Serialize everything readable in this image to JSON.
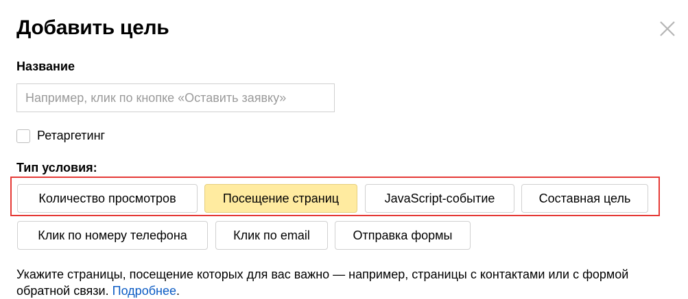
{
  "dialog": {
    "title": "Добавить цель",
    "close_icon": "close-icon"
  },
  "name_field": {
    "label": "Название",
    "value": "",
    "placeholder": "Например, клик по кнопке «Оставить заявку»"
  },
  "retargeting": {
    "label": "Ретаргетинг",
    "checked": false
  },
  "condition_type": {
    "label": "Тип условия:",
    "options": [
      {
        "label": "Количество просмотров",
        "selected": false
      },
      {
        "label": "Посещение страниц",
        "selected": true
      },
      {
        "label": "JavaScript-событие",
        "selected": false
      },
      {
        "label": "Составная цель",
        "selected": false
      },
      {
        "label": "Клик по номеру телефона",
        "selected": false
      },
      {
        "label": "Клик по email",
        "selected": false
      },
      {
        "label": "Отправка формы",
        "selected": false
      }
    ]
  },
  "description": {
    "text": "Укажите страницы, посещение которых для вас важно — например, страницы с контактами или с формой обратной связи. ",
    "link_text": "Подробнее",
    "trailing": "."
  },
  "colors": {
    "selected_bg": "#ffeba0",
    "highlight_border": "#e53935",
    "link": "#0b5bc4"
  }
}
